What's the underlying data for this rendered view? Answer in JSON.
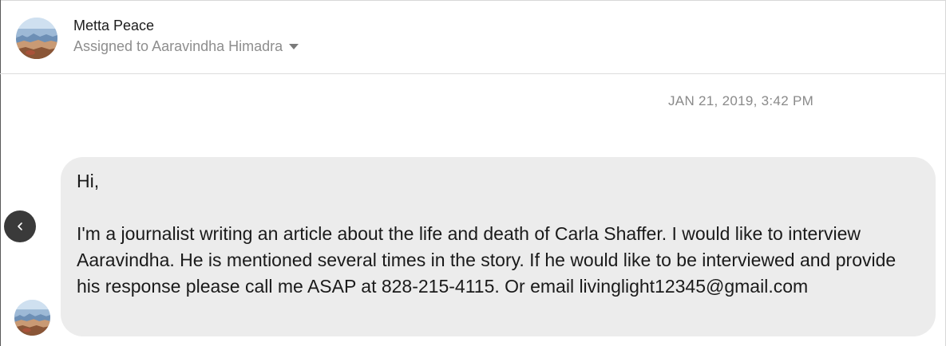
{
  "header": {
    "contact_name": "Metta Peace",
    "assignment": "Assigned to Aaravindha Himadra"
  },
  "conversation": {
    "timestamp": "JAN 21, 2019, 3:42 PM",
    "message": {
      "greeting": "Hi,",
      "body": "I'm a journalist writing an article about the life and death of Carla Shaffer. I would like to interview Aaravindha. He is mentioned several times in the story. If he would like to be interviewed and provide his response please call me ASAP at 828-215-4115. Or email livinglight12345@gmail.com"
    }
  },
  "icons": {
    "avatar": "landscape-avatar-icon",
    "assignee_dropdown": "caret-down-icon",
    "back": "chevron-left-icon"
  },
  "colors": {
    "bubble_background": "#ececec",
    "secondary_text": "#8e8e8e",
    "nav_button": "#3a3a3a"
  }
}
